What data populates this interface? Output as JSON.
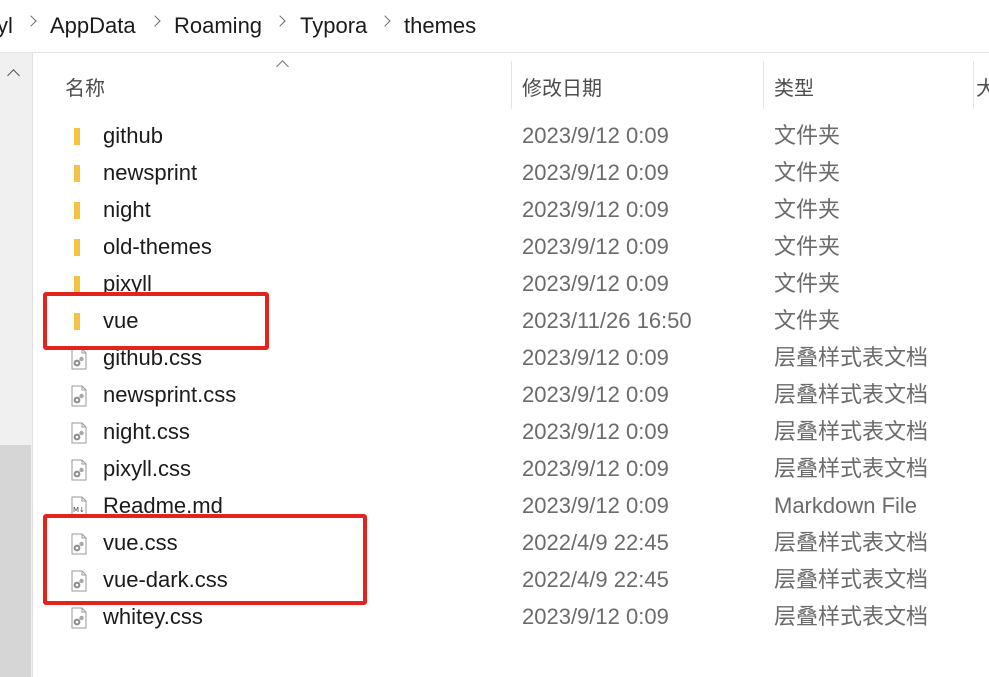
{
  "breadcrumb": [
    "yl",
    "AppData",
    "Roaming",
    "Typora",
    "themes"
  ],
  "columns": {
    "name": "名称",
    "modified": "修改日期",
    "type": "类型",
    "size_cut": "大"
  },
  "colors": {
    "folder": "#f4c242",
    "highlight": "#e3231c"
  },
  "rows": [
    {
      "name": "github",
      "date": "2023/9/12 0:09",
      "type": "文件夹",
      "icon": "folder-icon"
    },
    {
      "name": "newsprint",
      "date": "2023/9/12 0:09",
      "type": "文件夹",
      "icon": "folder-icon"
    },
    {
      "name": "night",
      "date": "2023/9/12 0:09",
      "type": "文件夹",
      "icon": "folder-icon"
    },
    {
      "name": "old-themes",
      "date": "2023/9/12 0:09",
      "type": "文件夹",
      "icon": "folder-icon"
    },
    {
      "name": "pixyll",
      "date": "2023/9/12 0:09",
      "type": "文件夹",
      "icon": "folder-icon"
    },
    {
      "name": "vue",
      "date": "2023/11/26 16:50",
      "type": "文件夹",
      "icon": "folder-icon"
    },
    {
      "name": "github.css",
      "date": "2023/9/12 0:09",
      "type": "层叠样式表文档",
      "icon": "css-file-icon"
    },
    {
      "name": "newsprint.css",
      "date": "2023/9/12 0:09",
      "type": "层叠样式表文档",
      "icon": "css-file-icon"
    },
    {
      "name": "night.css",
      "date": "2023/9/12 0:09",
      "type": "层叠样式表文档",
      "icon": "css-file-icon"
    },
    {
      "name": "pixyll.css",
      "date": "2023/9/12 0:09",
      "type": "层叠样式表文档",
      "icon": "css-file-icon"
    },
    {
      "name": "Readme.md",
      "date": "2023/9/12 0:09",
      "type": "Markdown File",
      "icon": "markdown-file-icon"
    },
    {
      "name": "vue.css",
      "date": "2022/4/9 22:45",
      "type": "层叠样式表文档",
      "icon": "css-file-icon"
    },
    {
      "name": "vue-dark.css",
      "date": "2022/4/9 22:45",
      "type": "层叠样式表文档",
      "icon": "css-file-icon"
    },
    {
      "name": "whitey.css",
      "date": "2023/9/12 0:09",
      "type": "层叠样式表文档",
      "icon": "css-file-icon"
    }
  ]
}
